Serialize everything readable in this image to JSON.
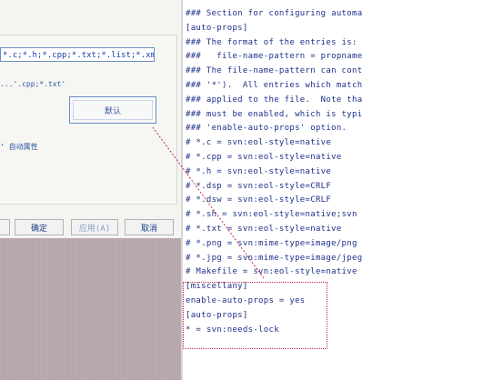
{
  "dialog": {
    "pattern_field_value": "*.c;*.h;*.cpp;*.txt;*.list;*.xml;*.html",
    "hint_text": "...'.cpp;*.txt'",
    "default_button_label": "默认",
    "checkbox_label": "’ 自动属性",
    "buttons": {
      "left_label": "",
      "ok_label": "确定",
      "apply_label": "应用(A)",
      "cancel_label": "取消"
    }
  },
  "editor": {
    "lines": [
      "### Section for configuring automa",
      "[auto-props]",
      "### The format of the entries is:",
      "###   file-name-pattern = propname",
      "### The file-name-pattern can cont",
      "### '*').  All entries which match",
      "### applied to the file.  Note tha",
      "### must be enabled, which is typi",
      "### 'enable-auto-props' option.",
      "# *.c = svn:eol-style=native",
      "# *.cpp = svn:eol-style=native",
      "# *.h = svn:eol-style=native",
      "# *.dsp = svn:eol-style=CRLF",
      "# *.dsw = svn:eol-style=CRLF",
      "# *.sh = svn:eol-style=native;svn",
      "# *.txt = svn:eol-style=native",
      "# *.png = svn:mime-type=image/png",
      "# *.jpg = svn:mime-type=image/jpeg",
      "# Makefile = svn:eol-style=native",
      "[miscellany]",
      "enable-auto-props = yes",
      "[auto-props]",
      "* = svn:needs-lock"
    ]
  },
  "colors": {
    "text_blue": "#1d2f8a",
    "highlight_red": "#c42a4a",
    "field_border": "#6a8fbf"
  }
}
